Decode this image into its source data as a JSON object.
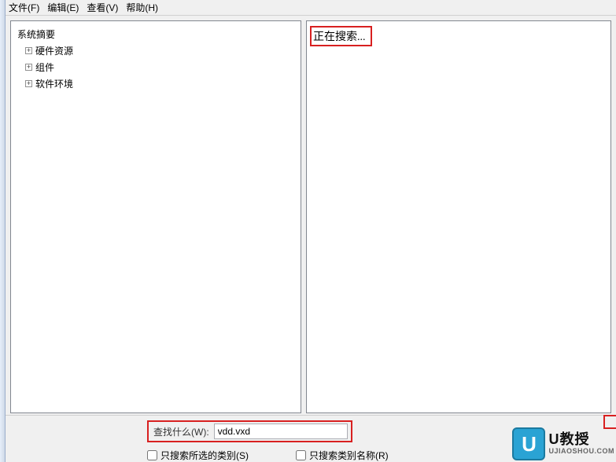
{
  "menubar": {
    "file": "文件(F)",
    "edit": "编辑(E)",
    "view": "查看(V)",
    "help": "帮助(H)"
  },
  "tree": {
    "root": "系统摘要",
    "nodes": [
      {
        "label": "硬件资源"
      },
      {
        "label": "组件"
      },
      {
        "label": "软件环境"
      }
    ]
  },
  "detail": {
    "status": "正在搜索..."
  },
  "search": {
    "label": "查找什么(W):",
    "value": "vdd.vxd"
  },
  "checks": {
    "selected_only": "只搜索所选的类别(S)",
    "names_only": "只搜索类别名称(R)"
  },
  "watermark": {
    "badge": "U",
    "title": "U教授",
    "sub": "UJIAOSHOU.COM"
  }
}
